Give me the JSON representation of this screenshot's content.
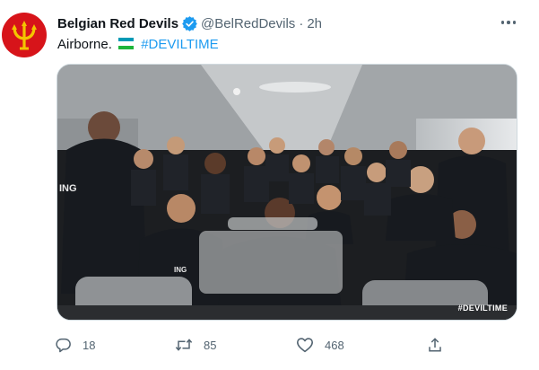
{
  "tweet": {
    "display_name": "Belgian Red Devils",
    "handle": "@BelRedDevils",
    "separator": "·",
    "time": "2h",
    "text_before": "Airborne.",
    "hashtag": "#DEVILTIME",
    "flag_icon": "uzbekistan-flag-icon",
    "avatar_icon": "red-devils-trident-logo",
    "verified_color": "#1d9bf0"
  },
  "media": {
    "watermark": "#DEVILTIME",
    "jersey_text_left": "ING",
    "jersey_text_right": "ING",
    "description_icon": "team-photo-airplane-cabin"
  },
  "actions": {
    "reply_count": "18",
    "retweet_count": "85",
    "like_count": "468",
    "reply_icon": "reply-icon",
    "retweet_icon": "retweet-icon",
    "like_icon": "heart-icon",
    "share_icon": "share-icon"
  }
}
